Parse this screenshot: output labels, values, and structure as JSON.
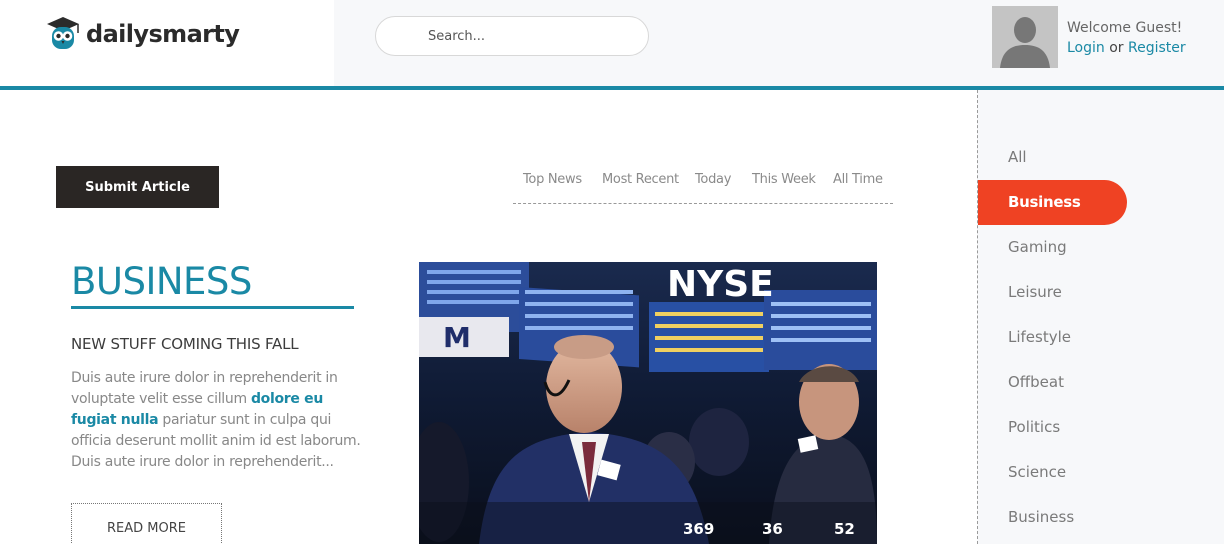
{
  "header": {
    "logo": {
      "text": "dailysmarty",
      "icon": "owl-graduation-cap-icon"
    },
    "search": {
      "placeholder": "Search..."
    },
    "user": {
      "avatar": "user-avatar-placeholder",
      "welcome": "Welcome Guest!",
      "login": "Login",
      "or": "or",
      "register": "Register"
    }
  },
  "main": {
    "submit_button": "Submit Article",
    "filters": [
      "Top News",
      "Most Recent",
      "Today",
      "This Week",
      "All Time"
    ],
    "category_title": "BUSINESS",
    "post": {
      "title": "NEW STUFF COMING THIS FALL",
      "body_part1": "Duis aute irure dolor in reprehenderit in voluptate velit esse cillum ",
      "body_highlight": "dolore eu fugiat nulla",
      "body_part2": " pariatur sunt in culpa qui officia deserunt mollit anim id est laborum. Duis aute irure dolor in reprehenderit...",
      "read_more": "READ MORE",
      "image_text": "NYSE",
      "stats": [
        "369",
        "36",
        "52"
      ]
    }
  },
  "sidebar": {
    "categories": [
      "All",
      "Business",
      "Gaming",
      "Leisure",
      "Lifestyle",
      "Offbeat",
      "Politics",
      "Science",
      "Business"
    ],
    "active_index": 1
  },
  "colors": {
    "accent": "#1a89a5",
    "active": "#ef4223",
    "button_dark": "#2a2624"
  }
}
